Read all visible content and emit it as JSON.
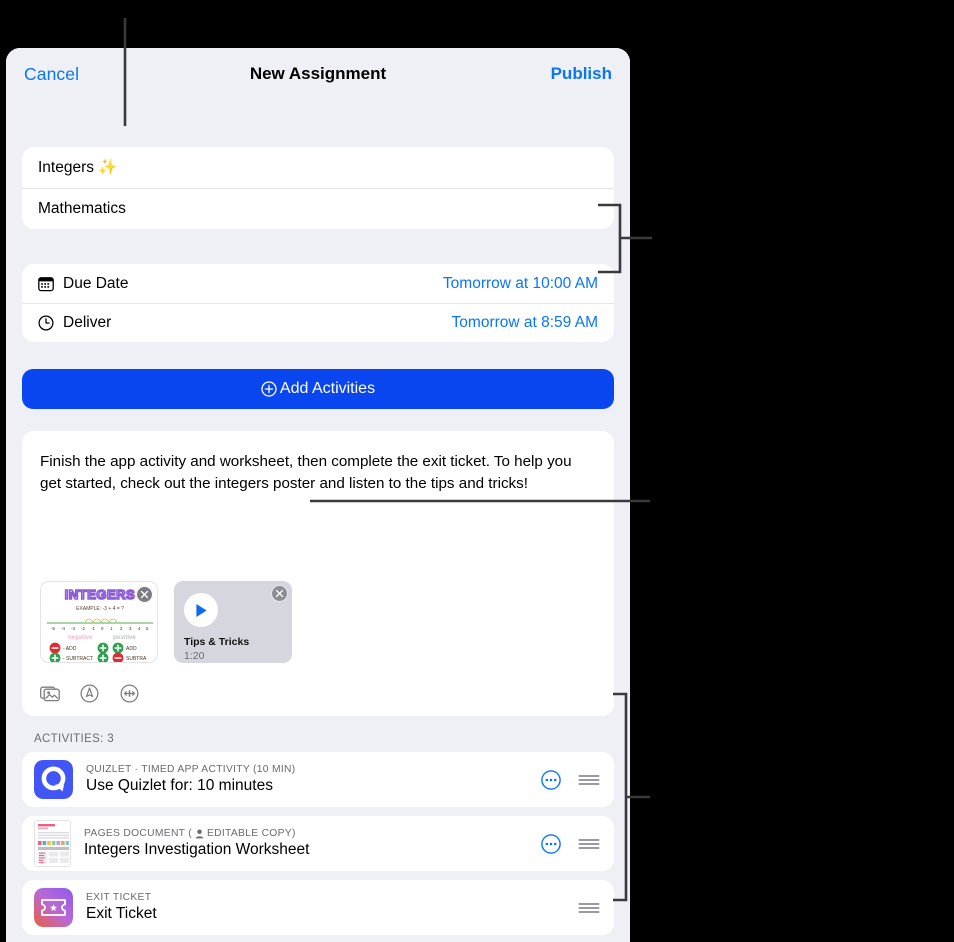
{
  "window": {
    "background_color": "#000000",
    "sheet_background": "#EFEFF6"
  },
  "navbar": {
    "cancel_label": "Cancel",
    "title": "New Assignment",
    "publish_label": "Publish",
    "accent_color": "#0A76F6"
  },
  "form": {
    "title_value": "Integers ✨",
    "subject_value": "Mathematics"
  },
  "schedule": {
    "due": {
      "icon": "calendar-icon",
      "label": "Due Date",
      "value": "Tomorrow at 10:00 AM"
    },
    "deliver": {
      "icon": "clock-icon",
      "label": "Deliver",
      "value": "Tomorrow at 8:59 AM"
    }
  },
  "add_activities": {
    "label": "Add Activities",
    "icon": "plus-circle-icon",
    "background_color": "#0A46F0"
  },
  "description": {
    "text": "Finish the app activity and worksheet, then complete the exit ticket. To help you get started, check out the integers poster and listen to the tips and tricks!",
    "attachments": [
      {
        "type": "image",
        "name": "integers-poster",
        "poster_title": "INTEGERS",
        "poster_example": "EXAMPLE:  -3 + 4 = ?",
        "poster_left_label": "negative",
        "poster_right_label": "positive",
        "poster_rows": [
          "- ADD",
          "- SUBTRACT",
          "+ ADD",
          "+ SUBTRACT"
        ],
        "remove_label": "Remove attachment"
      },
      {
        "type": "video",
        "name": "tips-and-tricks-video",
        "title": "Tips & Tricks",
        "duration": "1:20",
        "remove_label": "Remove attachment"
      }
    ],
    "media_tools": [
      "photos-icon",
      "markup-pen-icon",
      "audio-recording-icon"
    ]
  },
  "activities": {
    "header": "ACTIVITIES: 3",
    "items": [
      {
        "thumb": "quizlet-app-icon",
        "kicker": "QUIZLET · TIMED APP ACTIVITY (10 MIN)",
        "kicker_has_person_icon": false,
        "title": "Use Quizlet for: 10 minutes",
        "has_more": true,
        "has_grip": true
      },
      {
        "thumb": "pages-document-thumbnail",
        "kicker_pre": "PAGES DOCUMENT  (",
        "kicker_has_person_icon": true,
        "kicker_post": "EDITABLE COPY)",
        "kicker": "PAGES DOCUMENT  ( EDITABLE COPY)",
        "title": "Integers Investigation Worksheet",
        "has_more": true,
        "has_grip": true
      },
      {
        "thumb": "exit-ticket-icon",
        "kicker": "EXIT TICKET",
        "kicker_has_person_icon": false,
        "title": "Exit Ticket",
        "has_more": false,
        "has_grip": true
      }
    ]
  },
  "callouts": {
    "color": "#3A3A3C",
    "items": [
      {
        "name": "title-field-callout",
        "type": "line"
      },
      {
        "name": "schedule-callout",
        "type": "bracket"
      },
      {
        "name": "attachments-callout",
        "type": "line"
      },
      {
        "name": "activities-callout",
        "type": "bracket"
      }
    ]
  }
}
